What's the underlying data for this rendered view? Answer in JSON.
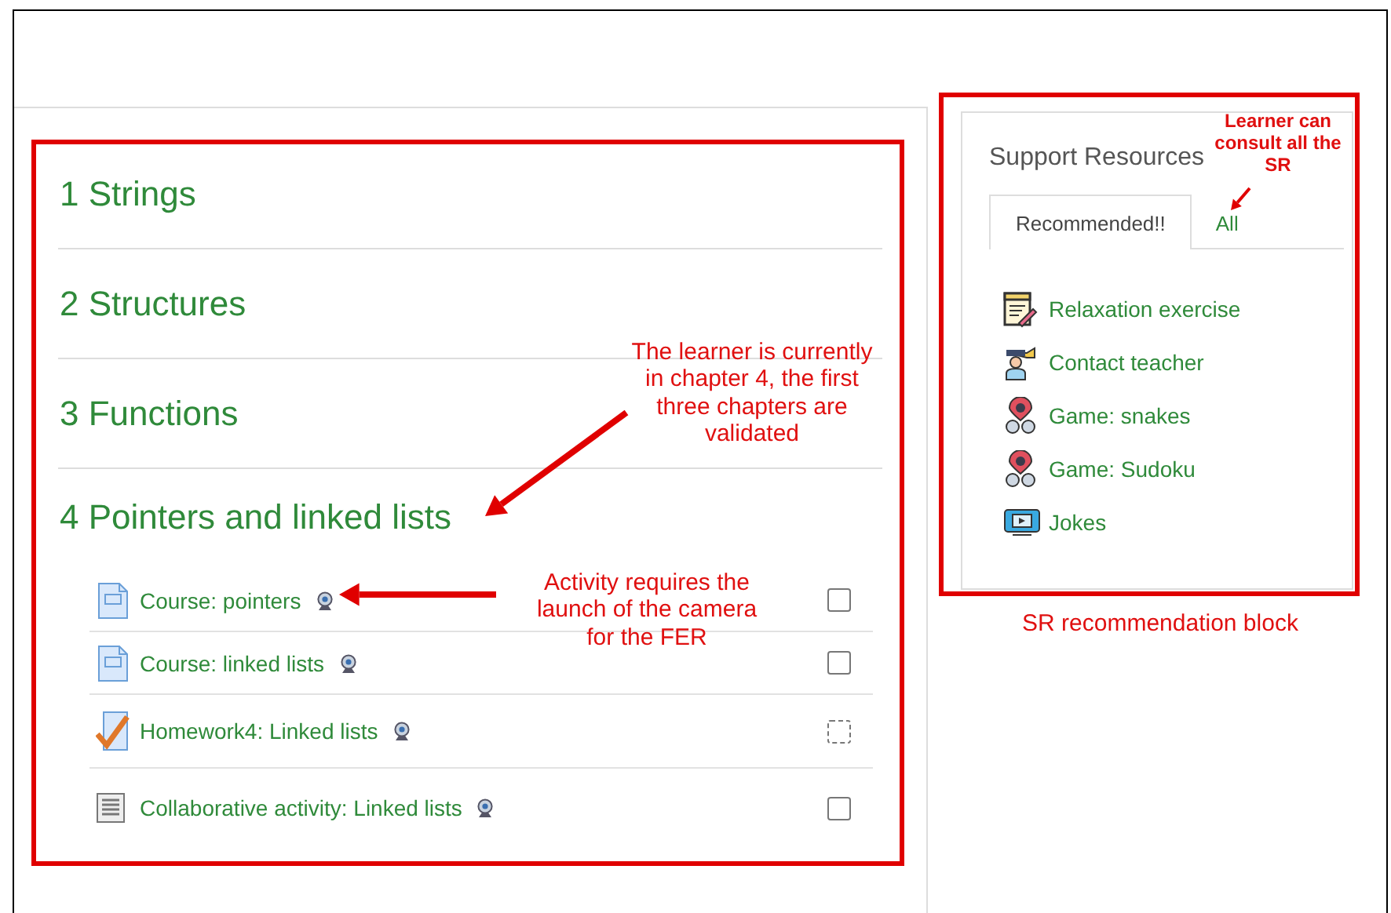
{
  "course": {
    "sections": [
      {
        "title": "1 Strings"
      },
      {
        "title": "2 Structures"
      },
      {
        "title": "3 Functions"
      },
      {
        "title": "4 Pointers and linked lists",
        "activities": [
          {
            "kind": "page",
            "title": "Course: pointers",
            "camera": true,
            "automatic": false,
            "checked": false
          },
          {
            "kind": "page",
            "title": "Course: linked lists",
            "camera": true,
            "automatic": false,
            "checked": false
          },
          {
            "kind": "assignment",
            "title": "Homework4: Linked lists",
            "camera": true,
            "automatic": true,
            "checked": false
          },
          {
            "kind": "forum",
            "title": "Collaborative activity: Linked lists",
            "camera": true,
            "automatic": false,
            "checked": false
          }
        ]
      }
    ]
  },
  "support_resources": {
    "title": "Support Resources",
    "tabs": [
      {
        "label": "Recommended!!",
        "selected": true
      },
      {
        "label": "All",
        "selected": false
      }
    ],
    "items": [
      {
        "kind": "relaxation",
        "title": "Relaxation exercise"
      },
      {
        "kind": "contact",
        "title": "Contact teacher"
      },
      {
        "kind": "game",
        "title": "Game: snakes"
      },
      {
        "kind": "game",
        "title": "Game: Sudoku"
      },
      {
        "kind": "video",
        "title": "Jokes"
      }
    ]
  },
  "annotations": [
    {
      "text": "Learner can consult all the SR"
    },
    {
      "text": "The learner is currently in chapter 4, the first three chapters are validated"
    },
    {
      "text": "Activity requires the launch of the camera for the FER"
    },
    {
      "text": "SR recommendation block"
    }
  ]
}
